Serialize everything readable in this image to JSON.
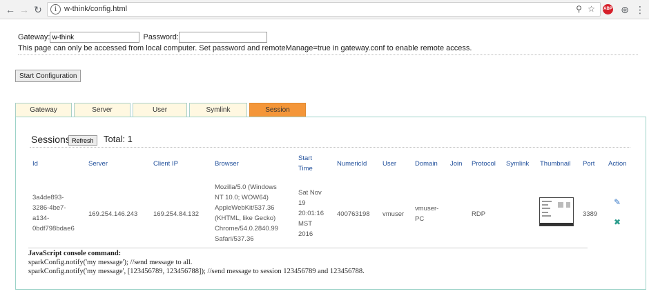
{
  "browser": {
    "url": "w-think/config.html",
    "back_icon": "arrow-left-icon",
    "forward_icon": "arrow-right-icon",
    "reload_icon": "reload-icon",
    "info_icon": "info-icon",
    "info_glyph": "i",
    "key_icon": "key-icon",
    "star_icon": "star-icon",
    "abp_label": "ABP"
  },
  "gateway": {
    "gateway_label": "Gateway:",
    "gateway_value": "w-think",
    "password_label": "Password:",
    "password_value": "",
    "notice": "This page can only be accessed from local computer. Set password and remoteManage=true in gateway.conf to enable remote access."
  },
  "start_button": "Start Configuration",
  "tabs": [
    {
      "label": "Gateway",
      "active": false
    },
    {
      "label": "Server",
      "active": false
    },
    {
      "label": "User",
      "active": false
    },
    {
      "label": "Symlink",
      "active": false
    },
    {
      "label": "Session",
      "active": true
    }
  ],
  "sessions": {
    "title": "Sessions",
    "refresh_label": "Refresh",
    "total_label": "Total: 1",
    "columns": [
      "Id",
      "Server",
      "Client IP",
      "Browser",
      "Start Time",
      "NumericId",
      "User",
      "Domain",
      "Join",
      "Protocol",
      "Symlink",
      "Thumbnail",
      "Port",
      "Action"
    ],
    "start_col_line1": "Start",
    "start_col_line2": "Time",
    "row": {
      "id_lines": [
        "3a4de893-",
        "3286-4be7-",
        "a134-",
        "0bdf798bdae6"
      ],
      "server": "169.254.146.243",
      "client_ip": "169.254.84.132",
      "browser_lines": [
        "Mozilla/5.0 (Windows",
        "NT 10.0; WOW64)",
        "AppleWebKit/537.36",
        "(KHTML, like Gecko)",
        "Chrome/54.0.2840.99",
        "Safari/537.36"
      ],
      "start_lines": [
        "Sat Nov",
        "19",
        "20:01:16",
        "MST",
        "2016"
      ],
      "numeric_id": "400763198",
      "user": "vmuser",
      "domain_lines": [
        "vmuser-",
        "PC"
      ],
      "join": "",
      "protocol": "RDP",
      "symlink": "",
      "port": "3389",
      "edit_icon": "edit-icon",
      "delete_icon": "close-icon"
    }
  },
  "js_console": {
    "heading": "JavaScript console command:",
    "line1": "sparkConfig.notify('my message'); //send message to all.",
    "line2": "sparkConfig.notify('my message', [123456789, 123456788]); //send message to session 123456789 and 123456788."
  }
}
